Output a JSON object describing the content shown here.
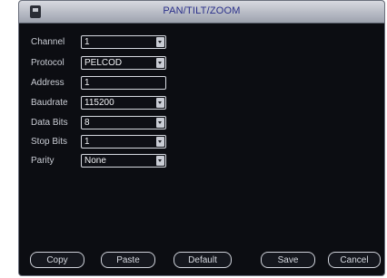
{
  "window": {
    "title": "PAN/TILT/ZOOM"
  },
  "form": {
    "channel": {
      "label": "Channel",
      "value": "1"
    },
    "protocol": {
      "label": "Protocol",
      "value": "PELCOD"
    },
    "address": {
      "label": "Address",
      "value": "1"
    },
    "baudrate": {
      "label": "Baudrate",
      "value": "115200"
    },
    "data_bits": {
      "label": "Data Bits",
      "value": "8"
    },
    "stop_bits": {
      "label": "Stop Bits",
      "value": "1"
    },
    "parity": {
      "label": "Parity",
      "value": "None"
    }
  },
  "buttons": {
    "copy": "Copy",
    "paste": "Paste",
    "default": "Default",
    "save": "Save",
    "cancel": "Cancel"
  }
}
